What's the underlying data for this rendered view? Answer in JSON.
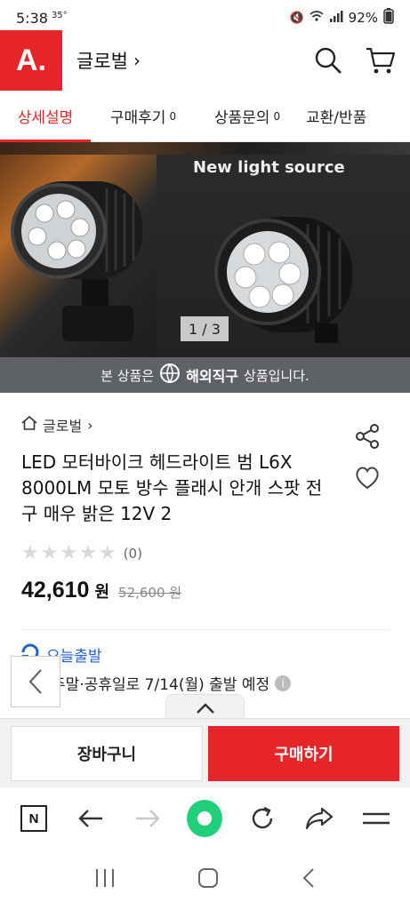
{
  "status_bar": {
    "time": "5:38",
    "extra": "35°",
    "battery": "92%"
  },
  "header": {
    "logo": "A.",
    "brand": "글로벌",
    "chevron": "›"
  },
  "tabs": [
    {
      "label": "상세설명",
      "count": ""
    },
    {
      "label": "구매후기",
      "count": "0"
    },
    {
      "label": "상품문의",
      "count": "0"
    },
    {
      "label": "교환/반품",
      "count": ""
    }
  ],
  "hero": {
    "caption": "New light source",
    "pager": "1 / 3"
  },
  "overseas": {
    "prefix": "본 상품은",
    "highlight": "해외직구",
    "suffix": "상품입니다."
  },
  "product": {
    "breadcrumb": "글로벌",
    "title": "LED 모터바이크 헤드라이트 범 L6X 8000LM 모토 방수 플래시 안개 스팟 전구 매우 밝은 12V 2",
    "rating_stars": 0,
    "review_count": "(0)",
    "price": "42,610",
    "currency": "원",
    "original_price": "52,600 원"
  },
  "shipping": {
    "label": "오늘출발",
    "text": "주말·공휴일로 7/14(월) 출발 예정",
    "info": "i"
  },
  "buttons": {
    "cart": "장바구니",
    "buy": "구매하기",
    "handle": "⌃"
  },
  "browser": {
    "n_label": "N"
  }
}
